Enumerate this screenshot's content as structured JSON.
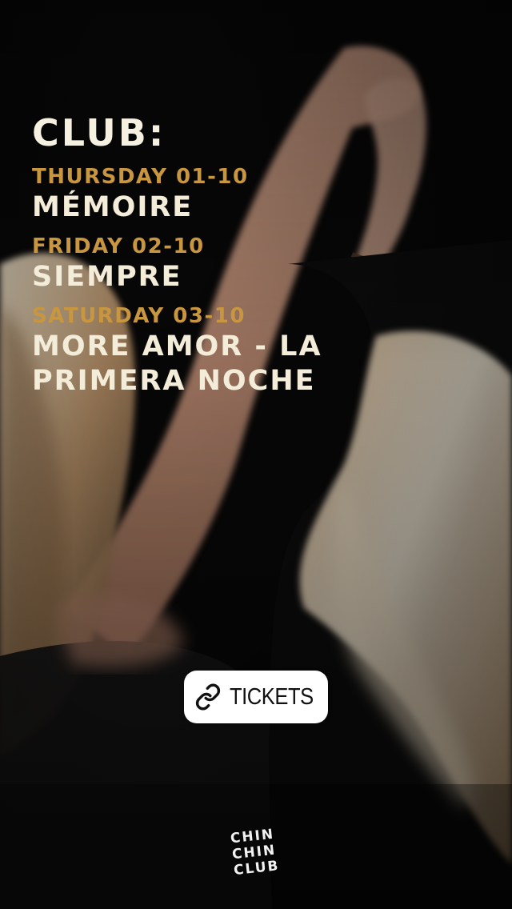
{
  "story": {
    "heading": "CLUB:",
    "events": [
      {
        "day": "THURSDAY 01-10",
        "name": "MÉMOIRE"
      },
      {
        "day": "FRIDAY 02-10",
        "name": "SIEMPRE"
      },
      {
        "day": "SATURDAY 03-10",
        "name": "MORE AMOR - LA PRIMERA NOCHE"
      }
    ]
  },
  "tickets_sticker": {
    "label": "TICKETS",
    "icon": "link-icon"
  },
  "logo": {
    "lines": [
      "CHIN",
      "CHIN",
      "CLUB"
    ]
  },
  "colors": {
    "day_text": "#c8963f",
    "title_text": "#f3ecd9",
    "background": "#060606"
  }
}
